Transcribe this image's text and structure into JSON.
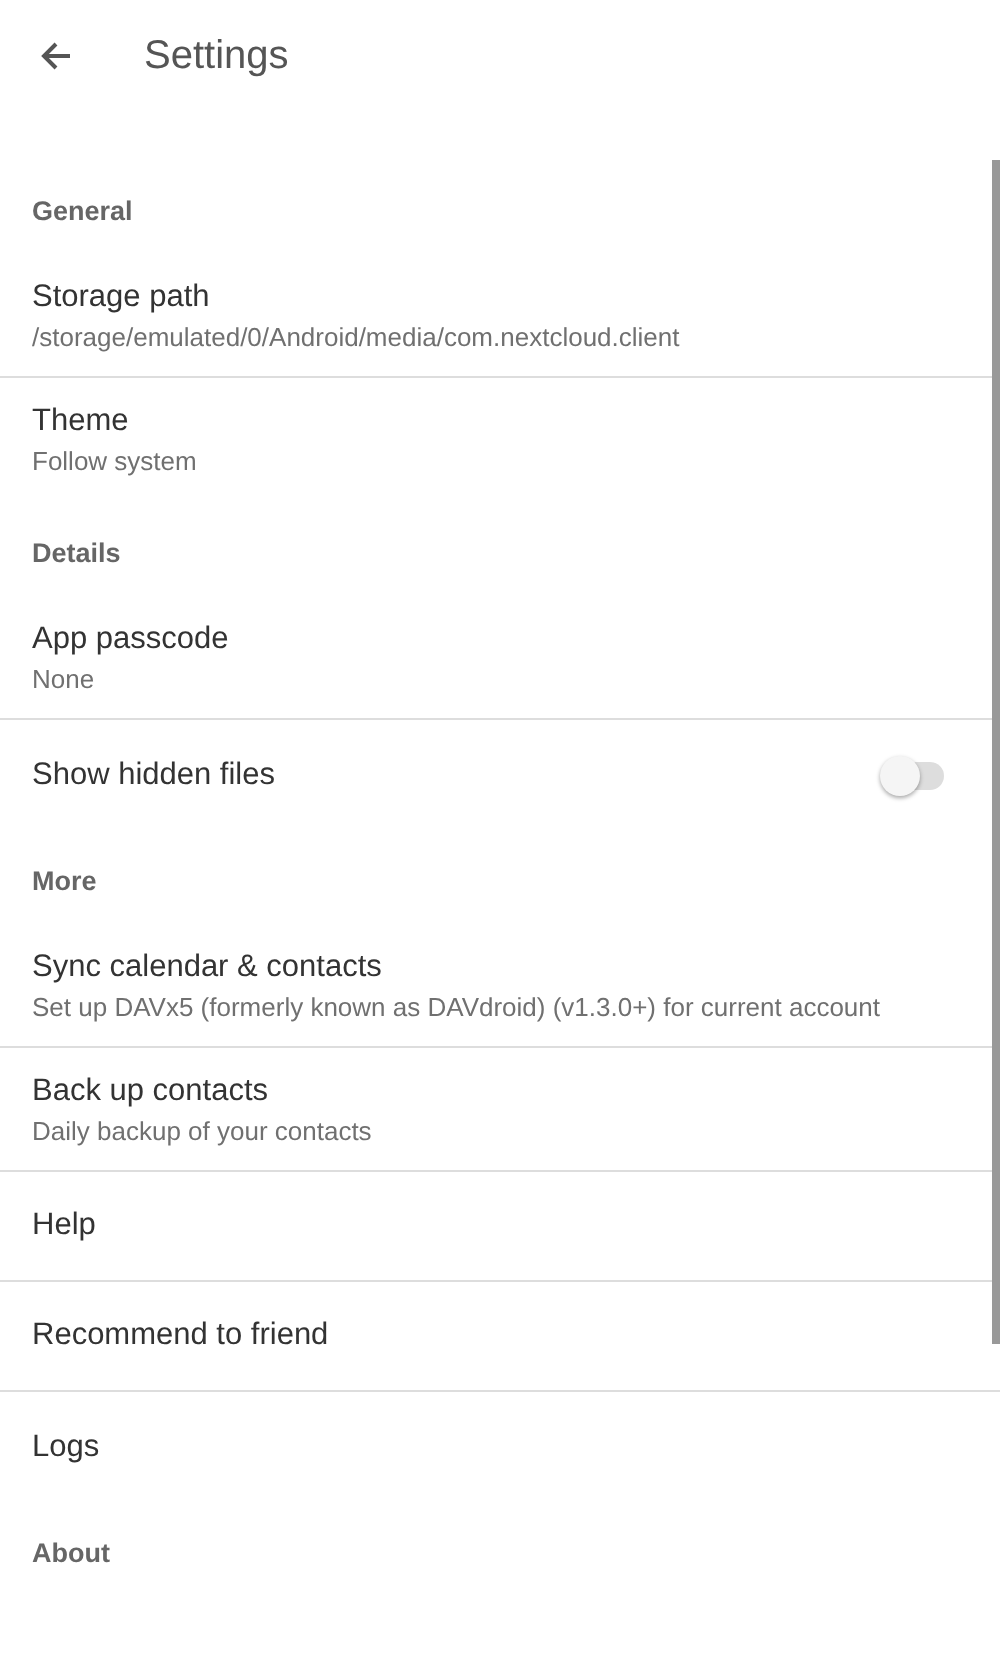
{
  "app_bar": {
    "title": "Settings"
  },
  "sections": [
    {
      "title": "General",
      "items": [
        {
          "kind": "text",
          "title": "Storage path",
          "summary": "/storage/emulated/0/Android/media/com.nextcloud.client"
        },
        {
          "kind": "text",
          "title": "Theme",
          "summary": "Follow system"
        }
      ]
    },
    {
      "title": "Details",
      "items": [
        {
          "kind": "text",
          "title": "App passcode",
          "summary": "None"
        },
        {
          "kind": "switch",
          "title": "Show hidden files",
          "on": false
        }
      ]
    },
    {
      "title": "More",
      "items": [
        {
          "kind": "text",
          "title": "Sync calendar & contacts",
          "summary": "Set up DAVx5 (formerly known as DAVdroid) (v1.3.0+) for current account"
        },
        {
          "kind": "text",
          "title": "Back up contacts",
          "summary": "Daily backup of your contacts"
        },
        {
          "kind": "text",
          "title": "Help"
        },
        {
          "kind": "text",
          "title": "Recommend to friend"
        },
        {
          "kind": "text",
          "title": "Logs"
        }
      ]
    },
    {
      "title": "About"
    }
  ]
}
